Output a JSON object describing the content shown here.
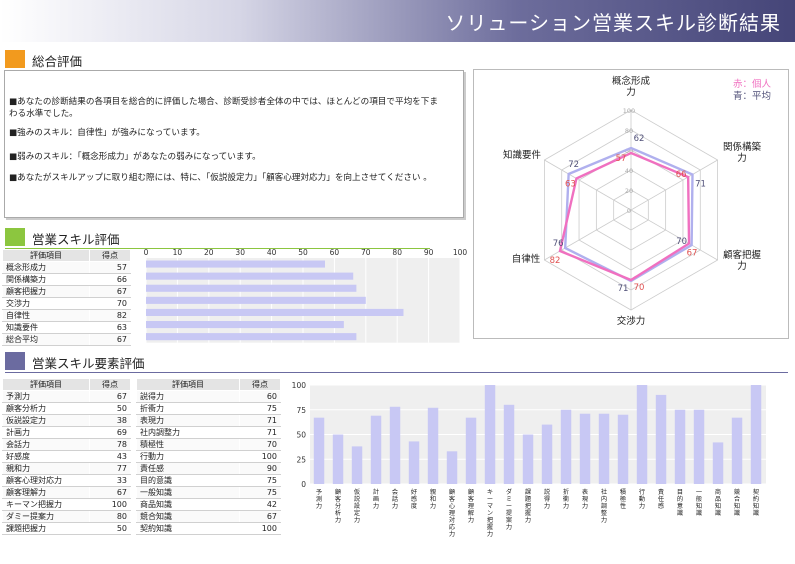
{
  "header": {
    "title": "ソリューション営業スキル診断結果"
  },
  "overall": {
    "title": "総合評価",
    "lines": [
      "■あなたの診断結果の各項目を総合的に評価した場合、診断受診者全体の中では、ほとんどの項目で平均を下ま",
      "わる水準でした。",
      "■強みのスキル：自律性」が強みになっています。",
      "■弱みのスキル：「概念形成力」があなたの弱みになっています。",
      "■あなたがスキルアップに取り組む際には、特に、「仮説設定力」「顧客心理対応力」を向上させてください 。"
    ]
  },
  "skill_eval": {
    "title": "営業スキル評価",
    "col_item": "評価項目",
    "col_score": "得点",
    "rows": [
      {
        "name": "概念形成力",
        "score": "57"
      },
      {
        "name": "関係構築力",
        "score": "66"
      },
      {
        "name": "顧客把握力",
        "score": "67"
      },
      {
        "name": "交渉力",
        "score": "70"
      },
      {
        "name": "自律性",
        "score": "82"
      },
      {
        "name": "知識要件",
        "score": "63"
      },
      {
        "name": "総合平均",
        "score": "67"
      }
    ]
  },
  "element_eval": {
    "title": "営業スキル要素評価",
    "col_item": "評価項目",
    "col_score": "得点",
    "left_rows": [
      {
        "name": "予測力",
        "score": "67"
      },
      {
        "name": "顧客分析力",
        "score": "50"
      },
      {
        "name": "仮説設定力",
        "score": "38"
      },
      {
        "name": "計画力",
        "score": "69"
      },
      {
        "name": "会話力",
        "score": "78"
      },
      {
        "name": "好感度",
        "score": "43"
      },
      {
        "name": "親和力",
        "score": "77"
      },
      {
        "name": "顧客心理対応力",
        "score": "33"
      },
      {
        "name": "顧客理解力",
        "score": "67"
      },
      {
        "name": "キーマン把握力",
        "score": "100"
      },
      {
        "name": "ダミー提案力",
        "score": "80"
      },
      {
        "name": "課題把握力",
        "score": "50"
      }
    ],
    "right_rows": [
      {
        "name": "説得力",
        "score": "60"
      },
      {
        "name": "折衝力",
        "score": "75"
      },
      {
        "name": "表現力",
        "score": "71"
      },
      {
        "name": "社内調整力",
        "score": "71"
      },
      {
        "name": "積極性",
        "score": "70"
      },
      {
        "name": "行動力",
        "score": "100"
      },
      {
        "name": "責任感",
        "score": "90"
      },
      {
        "name": "目的意識",
        "score": "75"
      },
      {
        "name": "一般知識",
        "score": "75"
      },
      {
        "name": "商品知識",
        "score": "42"
      },
      {
        "name": "競合知識",
        "score": "67"
      },
      {
        "name": "契約知識",
        "score": "100"
      }
    ]
  },
  "chart_data": [
    {
      "type": "bar",
      "orientation": "horizontal",
      "categories": [
        "概念形成力",
        "関係構築力",
        "顧客把握力",
        "交渉力",
        "自律性",
        "知識要件",
        "総合平均"
      ],
      "values": [
        57,
        66,
        67,
        70,
        82,
        63,
        67
      ],
      "xlim": [
        0,
        100
      ],
      "ticks": [
        "0",
        "10",
        "20",
        "30",
        "40",
        "50",
        "60",
        "70",
        "80",
        "90",
        "100"
      ],
      "grid": true,
      "bar_color": "#c8c8f4"
    },
    {
      "type": "radar",
      "axes": [
        "概念形成\n力",
        "関係構築\n力",
        "顧客把握\n力",
        "交渉力",
        "自律性",
        "知識要件"
      ],
      "ticks": [
        "0",
        "20",
        "40",
        "60",
        "80",
        "100"
      ],
      "series": [
        {
          "name": "赤：個人",
          "color": "#f070c0",
          "label_color": "#e05050",
          "values": [
            57,
            66,
            67,
            70,
            82,
            63
          ]
        },
        {
          "name": "青：平均",
          "color": "#b0b0ee",
          "label_color": "#505078",
          "values": [
            62,
            71,
            70,
            71,
            76,
            72
          ]
        }
      ]
    },
    {
      "type": "bar",
      "categories": [
        "予測力",
        "顧客分析力",
        "仮説設定力",
        "計画力",
        "会話力",
        "好感度",
        "親和力",
        "顧客心理対応力",
        "顧客理解力",
        "キーマン把握力",
        "ダミー提案力",
        "課題把握力",
        "説得力",
        "折衝力",
        "表現力",
        "社内調整力",
        "積極性",
        "行動力",
        "責任感",
        "目的意識",
        "一般知識",
        "商品知識",
        "競合知識",
        "契約知識"
      ],
      "values": [
        67,
        50,
        38,
        69,
        78,
        43,
        77,
        33,
        67,
        100,
        80,
        50,
        60,
        75,
        71,
        71,
        70,
        100,
        90,
        75,
        75,
        42,
        67,
        100
      ],
      "ylim": [
        0,
        100
      ],
      "ticks": [
        "0",
        "25",
        "50",
        "75",
        "100"
      ],
      "grid": true,
      "bar_color": "#c8c8f4"
    }
  ],
  "colors": {
    "orange": "#f29a1e",
    "green": "#8cc63f",
    "purple": "#6b6ba0"
  }
}
